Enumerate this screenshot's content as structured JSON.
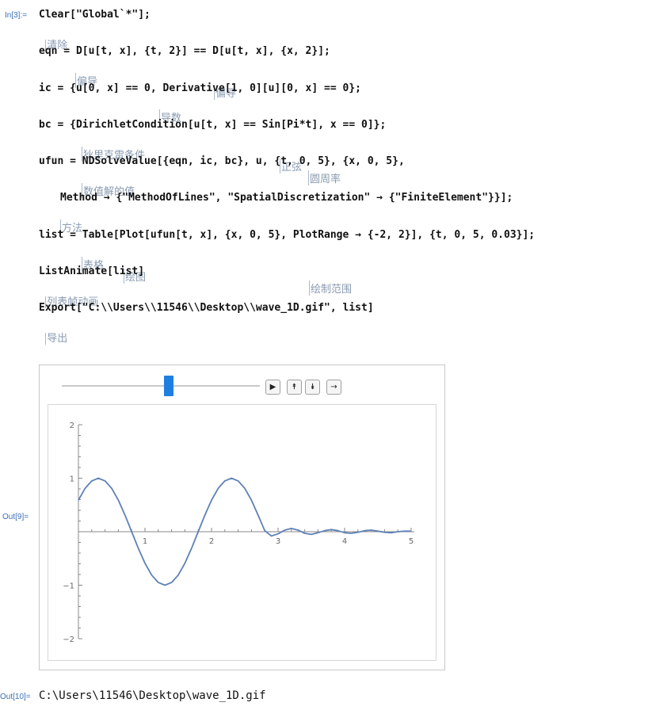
{
  "labels": {
    "in3": "In[3]:=",
    "out9": "Out[9]=",
    "out10": "Out[10]="
  },
  "code": {
    "line1": "Clear[\"Global`*\"];",
    "line2": "eqn = D[u[t, x], {t, 2}] == D[u[t, x], {x, 2}];",
    "line3": "ic = {u[0, x] == 0, Derivative[1, 0][u][0, x] == 0};",
    "line4": "bc = {DirichletCondition[u[t, x] == Sin[Pi*t], x == 0]};",
    "line5": "ufun = NDSolveValue[{eqn, ic, bc}, u, {t, 0, 5}, {x, 0, 5},",
    "line6": "Method → {\"MethodOfLines\", \"SpatialDiscretization\" → {\"FiniteElement\"}}];",
    "line7": "list = Table[Plot[ufun[t, x], {x, 0, 5}, PlotRange → {-2, 2}], {t, 0, 5, 0.03}];",
    "line8": "ListAnimate[list]",
    "line9": "Export[\"C:\\\\Users\\\\11546\\\\Desktop\\\\wave_1D.gif\", list]"
  },
  "hints": {
    "clear": "清除",
    "d1": "偏导",
    "d2": "偏导",
    "derivative": "导数",
    "dirichlet": "狄里克雷条件",
    "sin": "正弦",
    "pi": "圆周率",
    "ndsolve": "数值解的值",
    "method": "方法",
    "table": "表格",
    "plot": "绘图",
    "plotrange": "绘制范围",
    "listanimate": "列表帧动画",
    "export": "导出"
  },
  "animation": {
    "slider_position": 0.55,
    "buttons": {
      "play": "▶",
      "faster": "⯭",
      "slower": "⯯",
      "direction": "→"
    }
  },
  "chart_data": {
    "type": "line",
    "xlim": [
      0,
      5
    ],
    "ylim": [
      -2,
      2
    ],
    "x_ticks": [
      "1",
      "2",
      "3",
      "4",
      "5"
    ],
    "y_ticks": [
      "2",
      "1",
      "-1",
      "-2"
    ],
    "series": [
      {
        "color": "#5e81b5",
        "x": [
          0,
          0.1,
          0.2,
          0.3,
          0.4,
          0.5,
          0.6,
          0.7,
          0.8,
          0.9,
          1.0,
          1.1,
          1.2,
          1.3,
          1.4,
          1.5,
          1.6,
          1.7,
          1.8,
          1.9,
          2.0,
          2.1,
          2.2,
          2.3,
          2.4,
          2.5,
          2.6,
          2.7,
          2.8,
          2.9,
          3.0,
          3.1,
          3.2,
          3.3,
          3.4,
          3.5,
          3.6,
          3.7,
          3.8,
          3.9,
          4.0,
          4.1,
          4.2,
          4.3,
          4.4,
          4.5,
          4.6,
          4.7,
          4.8,
          4.9,
          5.0
        ],
        "y": [
          0.59,
          0.81,
          0.95,
          1.0,
          0.95,
          0.81,
          0.59,
          0.31,
          0.0,
          -0.31,
          -0.59,
          -0.81,
          -0.95,
          -1.0,
          -0.95,
          -0.81,
          -0.59,
          -0.31,
          0.0,
          0.31,
          0.59,
          0.81,
          0.95,
          1.0,
          0.95,
          0.81,
          0.59,
          0.31,
          0.02,
          -0.08,
          -0.04,
          0.03,
          0.06,
          0.03,
          -0.03,
          -0.05,
          -0.02,
          0.02,
          0.04,
          0.02,
          -0.02,
          -0.03,
          -0.01,
          0.02,
          0.03,
          0.01,
          -0.01,
          -0.02,
          0.0,
          0.01,
          0.01
        ]
      }
    ]
  }
}
